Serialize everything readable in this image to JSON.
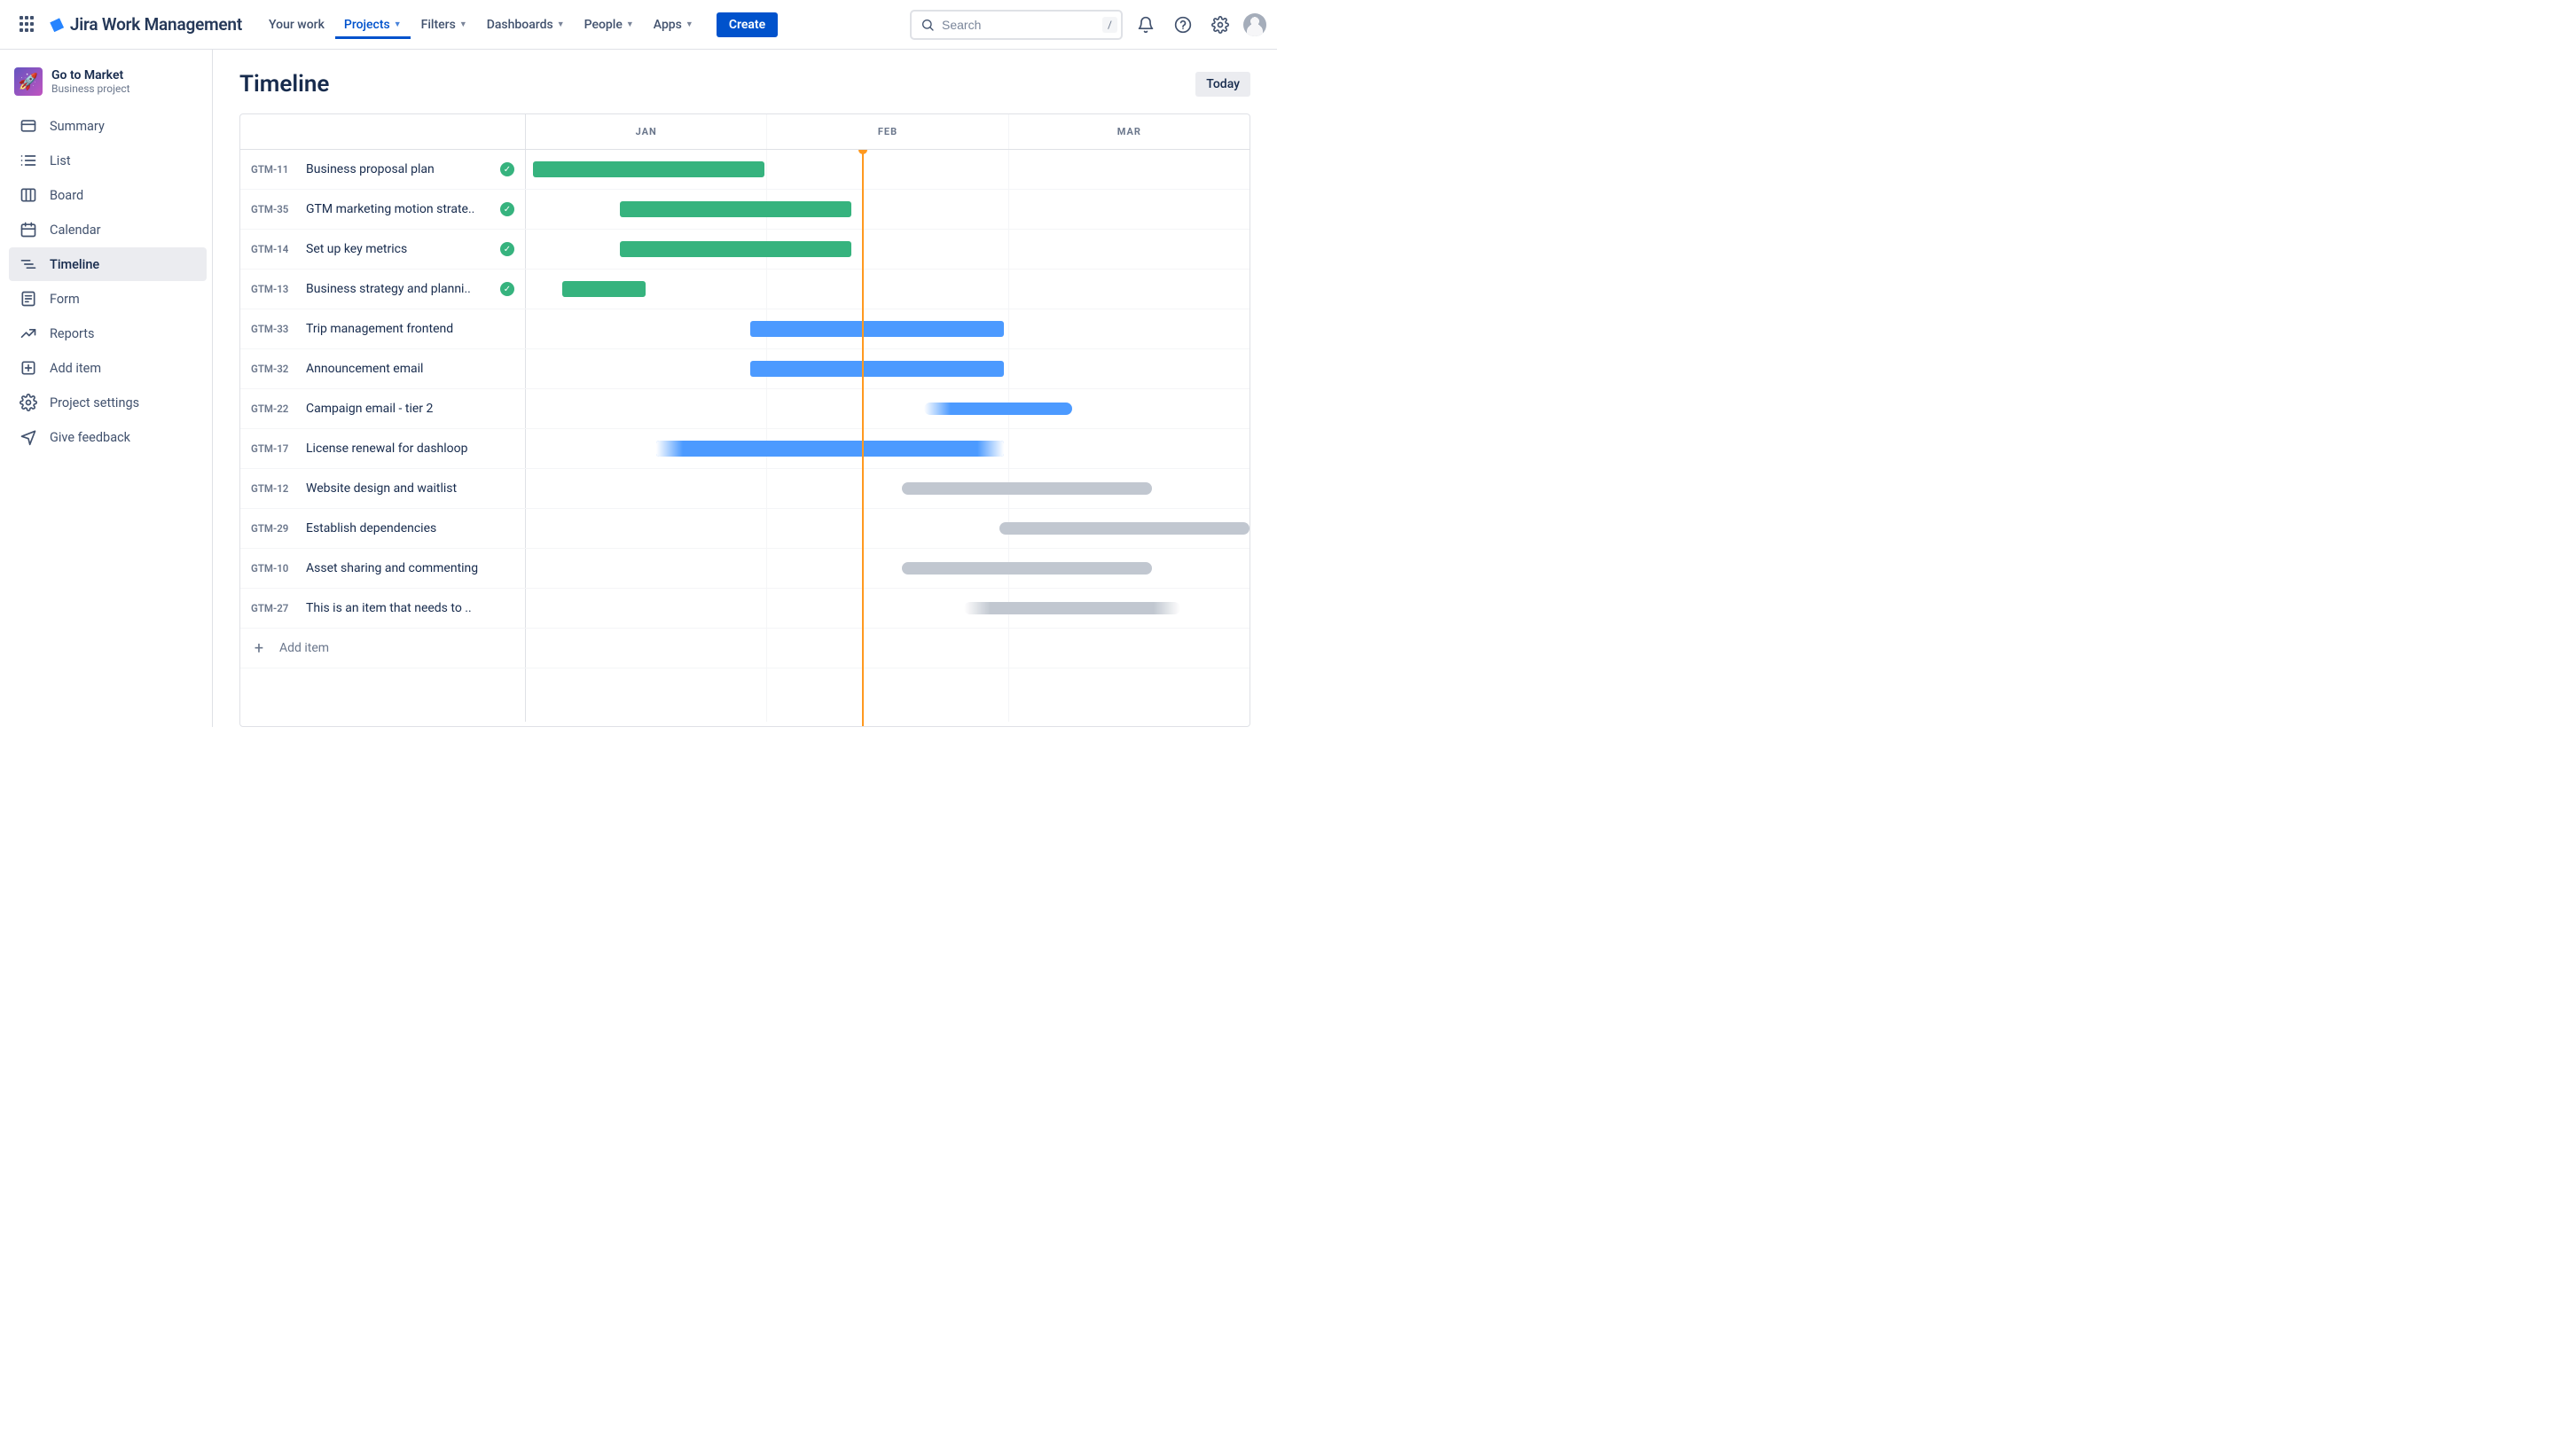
{
  "app": {
    "name": "Jira Work Management"
  },
  "nav": {
    "items": [
      {
        "label": "Your work",
        "hasChev": false,
        "active": false
      },
      {
        "label": "Projects",
        "hasChev": true,
        "active": true
      },
      {
        "label": "Filters",
        "hasChev": true,
        "active": false
      },
      {
        "label": "Dashboards",
        "hasChev": true,
        "active": false
      },
      {
        "label": "People",
        "hasChev": true,
        "active": false
      },
      {
        "label": "Apps",
        "hasChev": true,
        "active": false
      }
    ],
    "create": "Create"
  },
  "search": {
    "placeholder": "Search",
    "shortcut": "/"
  },
  "project": {
    "name": "Go to Market",
    "type": "Business project"
  },
  "sidebar": {
    "items": [
      {
        "label": "Summary",
        "icon": "summary"
      },
      {
        "label": "List",
        "icon": "list"
      },
      {
        "label": "Board",
        "icon": "board"
      },
      {
        "label": "Calendar",
        "icon": "calendar"
      },
      {
        "label": "Timeline",
        "icon": "timeline",
        "active": true
      },
      {
        "label": "Form",
        "icon": "form"
      },
      {
        "label": "Reports",
        "icon": "reports"
      },
      {
        "label": "Add item",
        "icon": "additem"
      },
      {
        "label": "Project settings",
        "icon": "settings"
      },
      {
        "label": "Give feedback",
        "icon": "feedback"
      }
    ]
  },
  "page": {
    "title": "Timeline",
    "today": "Today"
  },
  "timeline": {
    "months": [
      "JAN",
      "FEB",
      "MAR"
    ],
    "todayPct": 46.5,
    "addItem": "Add item",
    "rows": [
      {
        "key": "GTM-11",
        "title": "Business proposal plan",
        "done": true,
        "color": "green",
        "start": 1,
        "width": 32
      },
      {
        "key": "GTM-35",
        "title": "GTM marketing motion strate..",
        "done": true,
        "color": "green",
        "start": 13,
        "width": 32
      },
      {
        "key": "GTM-14",
        "title": "Set up key metrics",
        "done": true,
        "color": "green",
        "start": 13,
        "width": 32
      },
      {
        "key": "GTM-13",
        "title": "Business strategy and planni..",
        "done": true,
        "color": "green",
        "start": 5,
        "width": 11.5
      },
      {
        "key": "GTM-33",
        "title": "Trip management frontend",
        "done": false,
        "color": "blue",
        "start": 31,
        "width": 35
      },
      {
        "key": "GTM-32",
        "title": "Announcement email",
        "done": false,
        "color": "blue",
        "start": 31,
        "width": 35
      },
      {
        "key": "GTM-22",
        "title": "Campaign email - tier 2",
        "done": false,
        "color": "blue",
        "start": 55,
        "width": 20.5,
        "small": true,
        "fadeLeft": true
      },
      {
        "key": "GTM-17",
        "title": "License renewal for dashloop",
        "done": false,
        "color": "blue",
        "start": 18,
        "width": 48,
        "fadeLeft": true,
        "fadeRight": true
      },
      {
        "key": "GTM-12",
        "title": "Website design and waitlist",
        "done": false,
        "color": "gray",
        "start": 52,
        "width": 34.5,
        "small": true
      },
      {
        "key": "GTM-29",
        "title": "Establish dependencies",
        "done": false,
        "color": "gray",
        "start": 65.5,
        "width": 34.5,
        "small": true
      },
      {
        "key": "GTM-10",
        "title": "Asset sharing and commenting",
        "done": false,
        "color": "gray",
        "start": 52,
        "width": 34.5,
        "small": true
      },
      {
        "key": "GTM-27",
        "title": "This is an item that needs to ..",
        "done": false,
        "color": "gray",
        "start": 60.5,
        "width": 30,
        "small": true,
        "fadeLeft": true,
        "fadeRight": true
      }
    ]
  },
  "chart_data": {
    "type": "gantt",
    "time_axis": {
      "unit": "month",
      "categories": [
        "JAN",
        "FEB",
        "MAR"
      ],
      "today": "FEB mid"
    },
    "series": [
      {
        "key": "GTM-11",
        "name": "Business proposal plan",
        "status": "done",
        "start_month": "JAN-early",
        "end_month": "JAN-late"
      },
      {
        "key": "GTM-35",
        "name": "GTM marketing motion strategy",
        "status": "done",
        "start_month": "JAN-mid",
        "end_month": "FEB-mid"
      },
      {
        "key": "GTM-14",
        "name": "Set up key metrics",
        "status": "done",
        "start_month": "JAN-mid",
        "end_month": "FEB-mid"
      },
      {
        "key": "GTM-13",
        "name": "Business strategy and planning",
        "status": "done",
        "start_month": "JAN-early",
        "end_month": "JAN-mid"
      },
      {
        "key": "GTM-33",
        "name": "Trip management frontend",
        "status": "in-progress",
        "start_month": "FEB-early",
        "end_month": "MAR-early"
      },
      {
        "key": "GTM-32",
        "name": "Announcement email",
        "status": "in-progress",
        "start_month": "FEB-early",
        "end_month": "MAR-early"
      },
      {
        "key": "GTM-22",
        "name": "Campaign email - tier 2",
        "status": "in-progress",
        "start_month": "FEB-late",
        "end_month": "MAR-mid"
      },
      {
        "key": "GTM-17",
        "name": "License renewal for dashloop",
        "status": "in-progress",
        "start_month": "JAN-mid",
        "end_month": "MAR-early"
      },
      {
        "key": "GTM-12",
        "name": "Website design and waitlist",
        "status": "todo",
        "start_month": "FEB-late",
        "end_month": "MAR-late"
      },
      {
        "key": "GTM-29",
        "name": "Establish dependencies",
        "status": "todo",
        "start_month": "MAR-early",
        "end_month": "APR"
      },
      {
        "key": "GTM-10",
        "name": "Asset sharing and commenting",
        "status": "todo",
        "start_month": "FEB-late",
        "end_month": "MAR-late"
      },
      {
        "key": "GTM-27",
        "name": "This is an item that needs to ..",
        "status": "todo",
        "start_month": "MAR-early",
        "end_month": "MAR-late"
      }
    ]
  }
}
